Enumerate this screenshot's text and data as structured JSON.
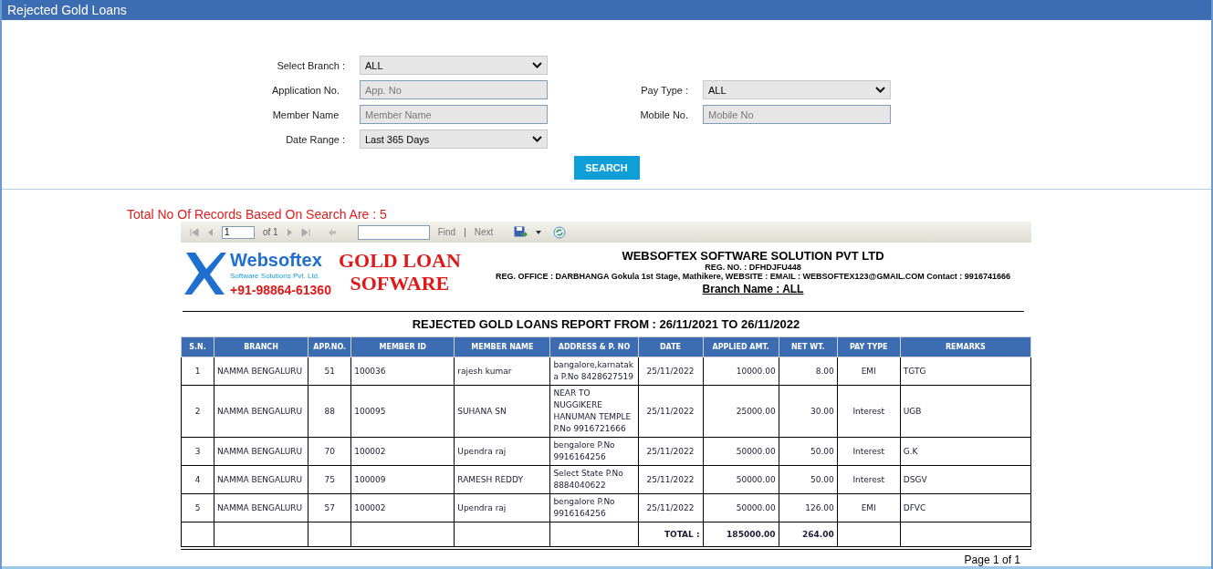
{
  "header": {
    "title": "Rejected Gold Loans"
  },
  "form_rows": [
    {
      "fields": [
        {
          "label": "Select Branch :",
          "kind": "select",
          "value": "ALL"
        }
      ]
    },
    {
      "fields": [
        {
          "label": "Application No.",
          "kind": "input",
          "placeholder": "App. No"
        },
        {
          "label": "Pay Type :",
          "kind": "select",
          "value": "ALL"
        }
      ]
    },
    {
      "fields": [
        {
          "label": "Member Name",
          "kind": "input",
          "placeholder": "Member Name"
        },
        {
          "label": "Mobile No.",
          "kind": "input",
          "placeholder": "Mobile No"
        }
      ]
    },
    {
      "fields": [
        {
          "label": "Date Range :",
          "kind": "select",
          "value": "Last 365 Days"
        }
      ]
    }
  ],
  "search_button": "SEARCH",
  "records_summary": "Total No Of Records Based On Search Are : 5",
  "toolbar": {
    "page_value": "1",
    "page_total": "of 1",
    "find_label": "Find",
    "separator": "|",
    "next_label": "Next"
  },
  "report": {
    "logo": {
      "brand": "Websoftex",
      "tagline": "Software Solutions Pvt. Ltd.",
      "phone": "+91-98864-61360"
    },
    "product_lines": [
      "GOLD LOAN",
      "SOFWARE"
    ],
    "company": "WEBSOFTEX SOFTWARE SOLUTION PVT LTD",
    "reg_no": "REG. NO. : DFHDJFU448",
    "office": "REG. OFFICE : DARBHANGA  Gokula 1st Stage, Mathikere, WEBSITE :        EMAIL : WEBSOFTEX123@GMAIL.COM   Contact : 9916741666",
    "branch_name": "Branch Name : ALL",
    "title": "REJECTED GOLD LOANS REPORT FROM : 26/11/2021 TO 26/11/2022",
    "table": {
      "columns": [
        "S.N.",
        "BRANCH",
        "APP.NO.",
        "MEMBER ID",
        "MEMBER NAME",
        "ADDRESS & P. NO",
        "DATE",
        "APPLIED AMT.",
        "NET WT.",
        "PAY TYPE",
        "REMARKS"
      ],
      "rows": [
        [
          "1",
          "NAMMA BENGALURU",
          "51",
          "100036",
          "rajesh kumar",
          "bangalore,karnataka P.No 8428627519",
          "25/11/2022",
          "10000.00",
          "8.00",
          "EMI",
          "TGTG"
        ],
        [
          "2",
          "NAMMA BENGALURU",
          "88",
          "100095",
          "SUHANA  SN",
          "NEAR TO NUGGIKERE HANUMAN TEMPLE P.No 9916721666",
          "25/11/2022",
          "25000.00",
          "30.00",
          "Interest",
          "UGB"
        ],
        [
          "3",
          "NAMMA BENGALURU",
          "70",
          "100002",
          "Upendra raj",
          "bengalore  P.No 9916164256",
          "25/11/2022",
          "50000.00",
          "50.00",
          "Interest",
          "G.K"
        ],
        [
          "4",
          "NAMMA BENGALURU",
          "75",
          "100009",
          "RAMESH REDDY",
          "Select State  P.No 8884040622",
          "25/11/2022",
          "50000.00",
          "50.00",
          "Interest",
          "DSGV"
        ],
        [
          "5",
          "NAMMA BENGALURU",
          "57",
          "100002",
          "Upendra raj",
          "bengalore  P.No 9916164256",
          "25/11/2022",
          "50000.00",
          "126.00",
          "EMI",
          "DFVC"
        ]
      ],
      "total": {
        "label": "TOTAL :",
        "applied": "185000.00",
        "net_wt": "264.00"
      }
    },
    "footer": "Page 1 of 1"
  }
}
